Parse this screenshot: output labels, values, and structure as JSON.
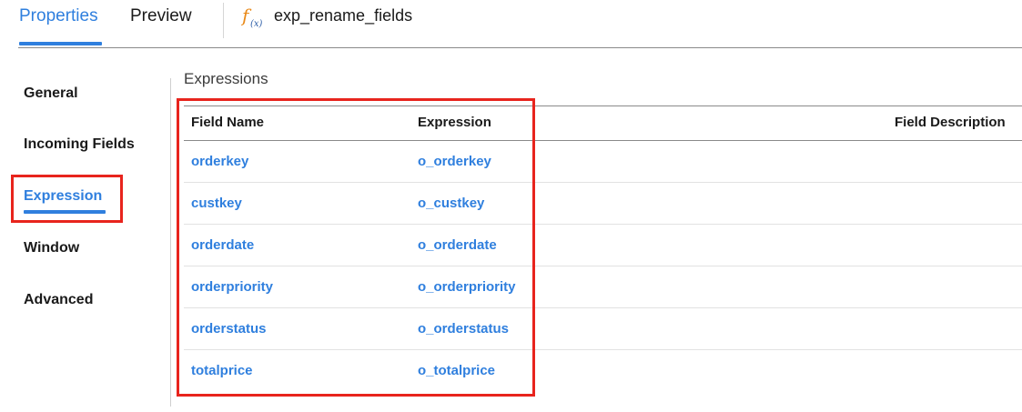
{
  "tabs": [
    {
      "label": "Properties",
      "active": true
    },
    {
      "label": "Preview",
      "active": false
    }
  ],
  "transformation": {
    "icon": "fx-icon",
    "name": "exp_rename_fields"
  },
  "nav": {
    "items": [
      {
        "label": "General",
        "active": false
      },
      {
        "label": "Incoming Fields",
        "active": false
      },
      {
        "label": "Expression",
        "active": true
      },
      {
        "label": "Window",
        "active": false
      },
      {
        "label": "Advanced",
        "active": false
      }
    ]
  },
  "expressions": {
    "title": "Expressions",
    "columns": [
      "Field Name",
      "Expression",
      "Field Description"
    ],
    "rows": [
      {
        "field": "orderkey",
        "expression": "o_orderkey",
        "description": ""
      },
      {
        "field": "custkey",
        "expression": "o_custkey",
        "description": ""
      },
      {
        "field": "orderdate",
        "expression": "o_orderdate",
        "description": ""
      },
      {
        "field": "orderpriority",
        "expression": "o_orderpriority",
        "description": ""
      },
      {
        "field": "orderstatus",
        "expression": "o_orderstatus",
        "description": ""
      },
      {
        "field": "totalprice",
        "expression": "o_totalprice",
        "description": ""
      }
    ]
  },
  "colors": {
    "accent": "#2f7fde",
    "highlight": "#e8241d",
    "fx_icon": "#e98a1a"
  }
}
